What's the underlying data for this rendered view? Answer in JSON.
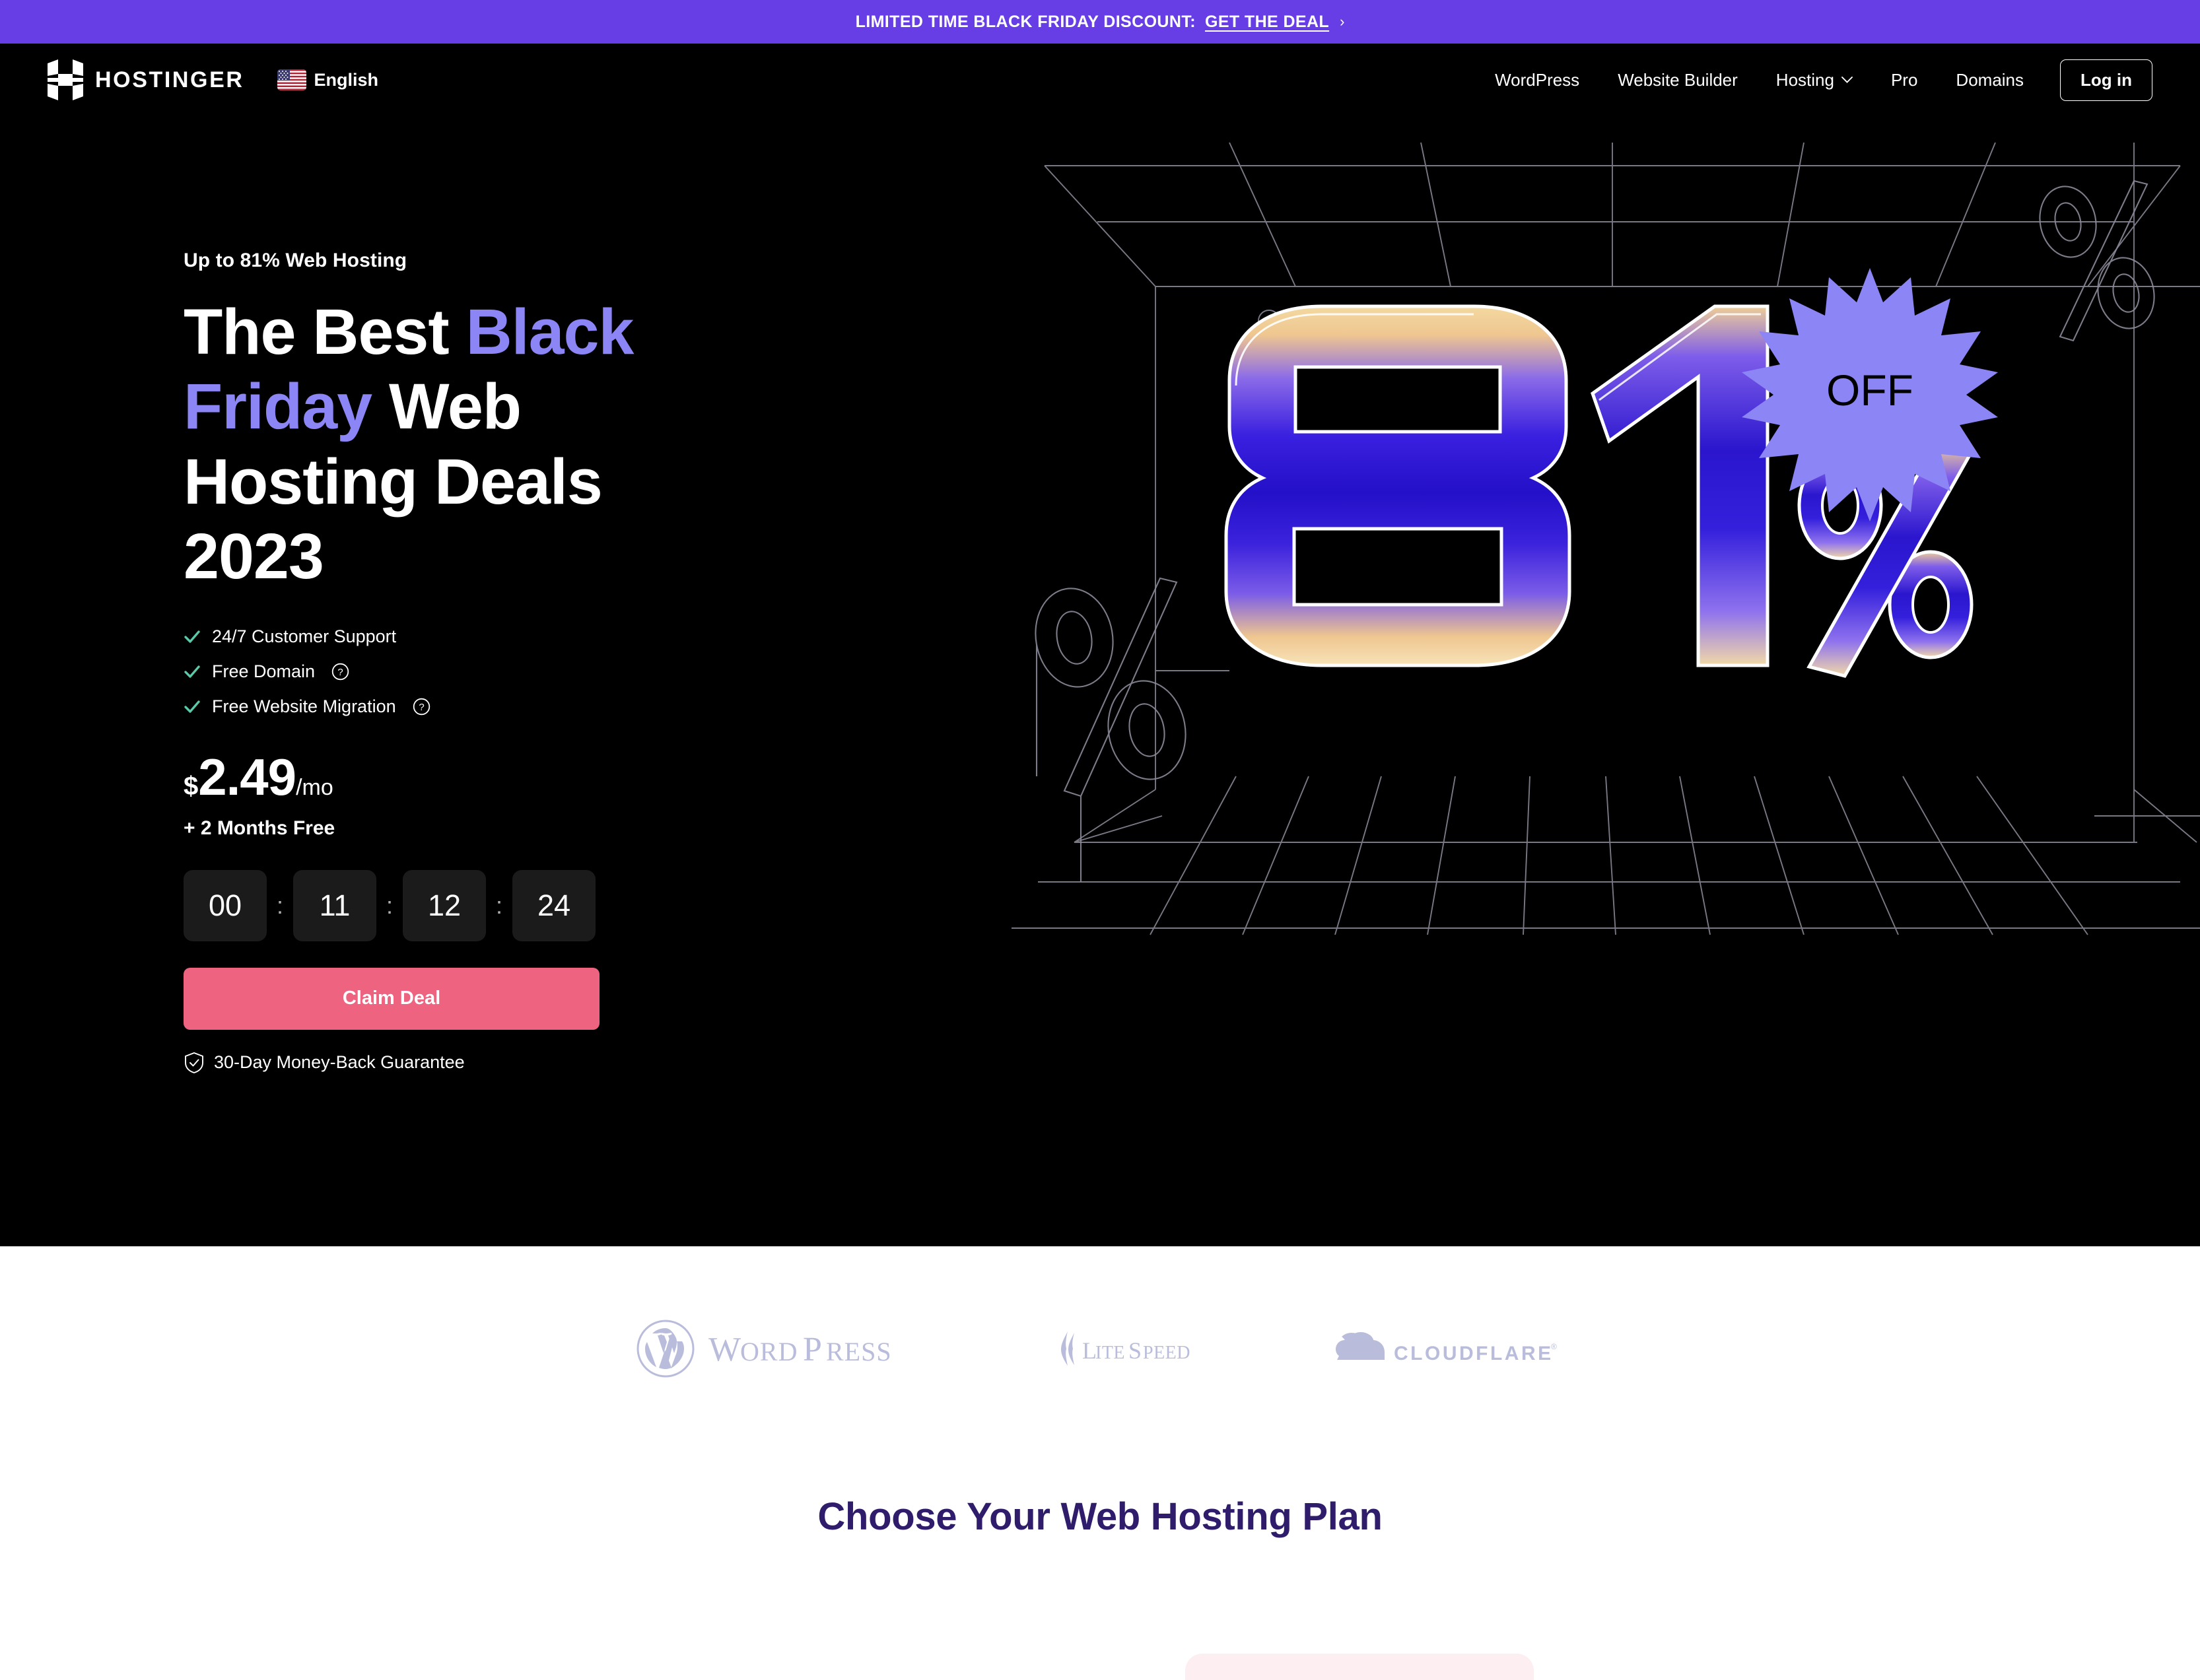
{
  "promo": {
    "text": "LIMITED TIME BLACK FRIDAY DISCOUNT:",
    "link_label": "GET THE DEAL",
    "chevron": "›",
    "background": "#673DE6"
  },
  "header": {
    "brand_name": "HOSTINGER",
    "logo_icon": "hostinger-h-logo",
    "language": {
      "label": "English",
      "flag_icon": "us-flag-icon"
    },
    "nav": [
      {
        "label": "WordPress",
        "has_chevron": false
      },
      {
        "label": "Website Builder",
        "has_chevron": false
      },
      {
        "label": "Hosting",
        "has_chevron": true
      },
      {
        "label": "Pro",
        "has_chevron": false
      },
      {
        "label": "Domains",
        "has_chevron": false
      }
    ],
    "login_label": "Log in"
  },
  "hero": {
    "eyebrow": "Up to 81% Web Hosting",
    "title_part1": "The Best ",
    "title_highlight1": "Black Friday",
    "title_part2": " Web Hosting Deals 2023",
    "title_line1_a": "The Best ",
    "title_line1_b": "Black",
    "title_line2_a": "Friday",
    "title_line2_b": " Web",
    "title_line3": "Hosting Deals",
    "title_line4": "2023",
    "highlight_color": "#8C85F5",
    "features": [
      {
        "label": "24/7 Customer Support",
        "tooltip": false
      },
      {
        "label": "Free Domain",
        "tooltip": true
      },
      {
        "label": "Free Website Migration",
        "tooltip": true
      }
    ],
    "price": {
      "currency": "$",
      "amount": "2.49",
      "period": "/mo",
      "bonus": "+ 2 Months Free"
    },
    "countdown": {
      "separator": ":",
      "units": [
        "00",
        "11",
        "12",
        "24"
      ]
    },
    "cta_label": "Claim Deal",
    "guarantee_label": "30-Day Money-Back Guarantee",
    "guarantee_icon": "shield-check-icon",
    "artwork": {
      "big_number": "81",
      "badge_label": "OFF",
      "badge_color": "#8C85F5",
      "percent_symbols": [
        "%",
        "%",
        "%"
      ]
    },
    "background": "#000000"
  },
  "partners": {
    "logos": [
      {
        "name": "WordPress",
        "icon": "wordpress-logo"
      },
      {
        "name": "LiteSpeed",
        "icon": "litespeed-logo"
      },
      {
        "name": "Cloudflare",
        "icon": "cloudflare-logo"
      }
    ]
  },
  "plans": {
    "section_title": "Choose Your Web Hosting Plan",
    "title_color": "#2F1C6A",
    "card_color": "#FDEEF1"
  }
}
